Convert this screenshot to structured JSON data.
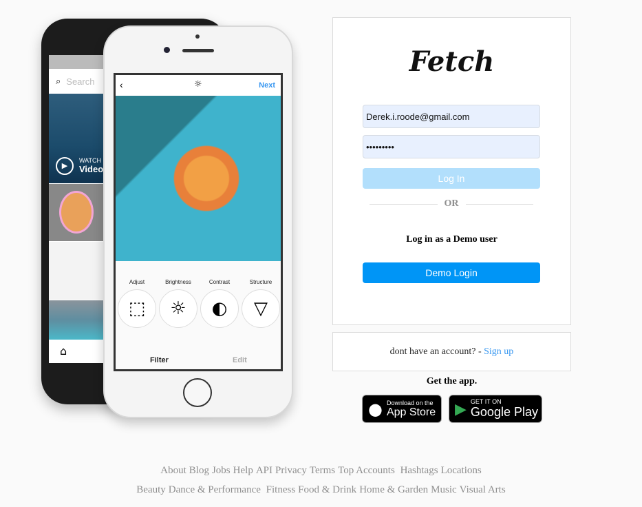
{
  "phone": {
    "search_placeholder": "Search",
    "watch_label": "WATCH",
    "video_label": "Video",
    "next_label": "Next",
    "tools": [
      "Adjust",
      "Brightness",
      "Contrast",
      "Structure"
    ],
    "tab_filter": "Filter",
    "tab_edit": "Edit"
  },
  "login": {
    "logo": "Fetch",
    "email_value": "Derek.i.roode@gmail.com",
    "password_value": "•••••••••",
    "login_button": "Log In",
    "or_label": "OR",
    "demo_heading": "Log in as a Demo user",
    "demo_button": "Demo Login",
    "colors": {
      "login_button": "#b2dffc",
      "demo_button": "#0095f6",
      "link": "#3897f0"
    }
  },
  "signup": {
    "text": "dont have an account? -",
    "link": "Sign up"
  },
  "get_app": {
    "title": "Get the app.",
    "app_store": {
      "small": "Download on the",
      "big": "App Store"
    },
    "google_play": {
      "small": "GET IT ON",
      "big": "Google Play"
    }
  },
  "footer": {
    "row1": [
      "About",
      "Blog",
      "Jobs",
      "Help",
      "API",
      "Privacy",
      "Terms",
      "Top Accounts",
      "Hashtags",
      "Locations"
    ],
    "row2": [
      "Beauty",
      "Dance & Performance",
      "Fitness",
      "Food & Drink",
      "Home & Garden",
      "Music",
      "Visual Arts"
    ]
  }
}
